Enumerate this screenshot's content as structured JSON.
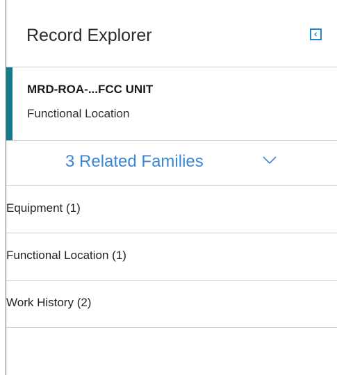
{
  "header": {
    "title": "Record Explorer",
    "collapse_icon": "chevron-left-icon"
  },
  "record": {
    "name": "MRD-ROA-...FCC UNIT",
    "type": "Functional Location",
    "accent_color": "#137b8a"
  },
  "families": {
    "label": "3 Related Families",
    "icon": "chevron-down-icon",
    "color": "#3a86d6",
    "items": [
      {
        "label": "Equipment (1)"
      },
      {
        "label": "Functional Location (1)"
      },
      {
        "label": "Work History (2)"
      }
    ]
  }
}
